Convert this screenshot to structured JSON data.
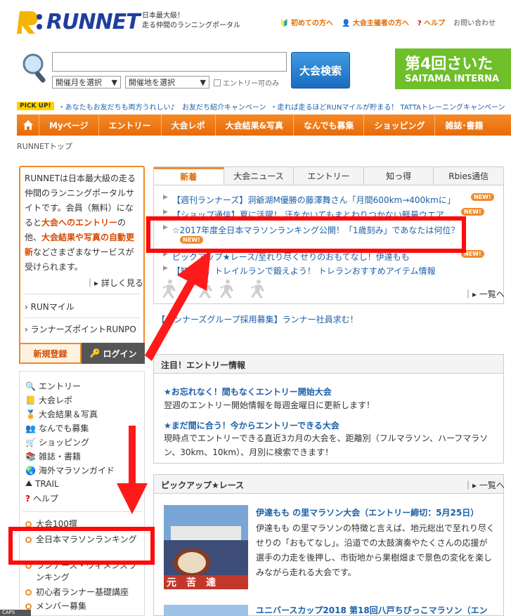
{
  "header": {
    "logo_text": "RUNNET",
    "tagline_1": "日本最大級！",
    "tagline_2": "走る仲間のランニングポータル",
    "links": [
      "初めての方へ",
      "大会主催者の方へ",
      "ヘルプ",
      "お問い合わせ"
    ]
  },
  "search": {
    "input_value": "",
    "month_select": "開催月を選択",
    "place_select": "開催地を選択",
    "entry_only_label": "エントリー可のみ",
    "button_label": "大会検索"
  },
  "banner": {
    "line1": "第4回さいた",
    "line2": "SAITAMA INTERNA"
  },
  "pickup": {
    "badge": "PICK UP!",
    "items": [
      "・あなたもお友だちも両方うれしい♪　お友だち紹介キャンペーン",
      "・走れば走るほどRUNマイルが貯まる！ TATTAトレーニングキャンペーン"
    ]
  },
  "nav": {
    "items": [
      "Myページ",
      "エントリー",
      "大会レポ",
      "大会結果&写真",
      "なんでも募集",
      "ショッピング",
      "雑誌･書籍"
    ]
  },
  "breadcrumb": "RUNNETトップ",
  "intro": {
    "text_1": "RUNNETは日本最大級の走る仲間のランニングポータルサイトです。会員（無料）になると",
    "bold_1": "大会へのエントリー",
    "text_2": "の他、",
    "bold_2": "大会結果や写真の自動更新",
    "text_3": "などさまざまなサービスが受けられます。",
    "more": "詳しく見る",
    "links": [
      "RUNマイル",
      "ランナーズポイントRUNPO"
    ],
    "register": "新規登録",
    "login": "ログイン"
  },
  "sidebar": {
    "items": [
      "エントリー",
      "大会レポ",
      "大会結果＆写真",
      "なんでも募集",
      "ショッピング",
      "雑誌・書籍",
      "海外マラソンガイド",
      "TRAIL",
      "ヘルプ"
    ],
    "sub_items": [
      "大会100撰",
      "全日本マラソンランキング",
      "ランナーズ・ウィメンズランキング",
      "初心者ランナー基礎講座",
      "メンバー募集"
    ]
  },
  "news": {
    "tabs": [
      "新着",
      "大会ニュース",
      "エントリー",
      "知っ得",
      "Rbies通信"
    ],
    "items": [
      "【週刊ランナーズ】洞爺湖M優勝の藤澤舞さん「月間600km→400kmに」",
      "【ショップ通信】夏に活躍！ 汗をかいてもまとわりつかない軽量ウエア",
      "☆2017年度全日本マラソンランキング公開！「1歳刻み」であなたは何位？",
      "ピックアップ★レース/至れり尽くせりのおもてなし！伊達もも",
      "【知っ得】トレイルランで鍛えよう！ トレランおすすめアイテム情報"
    ],
    "new_badge": "NEW!",
    "more": "一覧へ",
    "recruit": "【ランナーズグループ採用募集】ランナー社員求む！"
  },
  "entry_info": {
    "title": "注目！エントリー情報",
    "t1": "★お忘れなく！間もなくエントリー開始大会",
    "d1": "翌週のエントリー開始情報を毎週金曜日に更新します！",
    "t2": "★まだ間に合う！今からエントリーできる大会",
    "d2": "現時点でエントリーできる直近3カ月の大会を、距離別（フルマラソン、ハーフマラソン、30km、10km）、月別に検索できます！"
  },
  "pickup_race": {
    "title": "ピックアップ★レース",
    "more": "一覧へ",
    "race1_title": "伊達もも の里マラソン大会（エントリー締切：5月25日）",
    "race1_desc": "伊達もも の里マラソンの特徴と言えば、地元総出で至れり尽くせりの「おもてなし」。沿道での太鼓演奏やたくさんの応援が選手の力走を後押し、市街地から果樹畑まで景色の変化を楽しみながら走れる大会です。",
    "race2_title": "ユニバースカップ2018 第18回八戸ちびっこマラソン（エン"
  },
  "caps_label": "CAPS",
  "colors": {
    "accent": "#f08a2a",
    "link": "#1a5fa8",
    "annotation": "#ff0a0a"
  }
}
